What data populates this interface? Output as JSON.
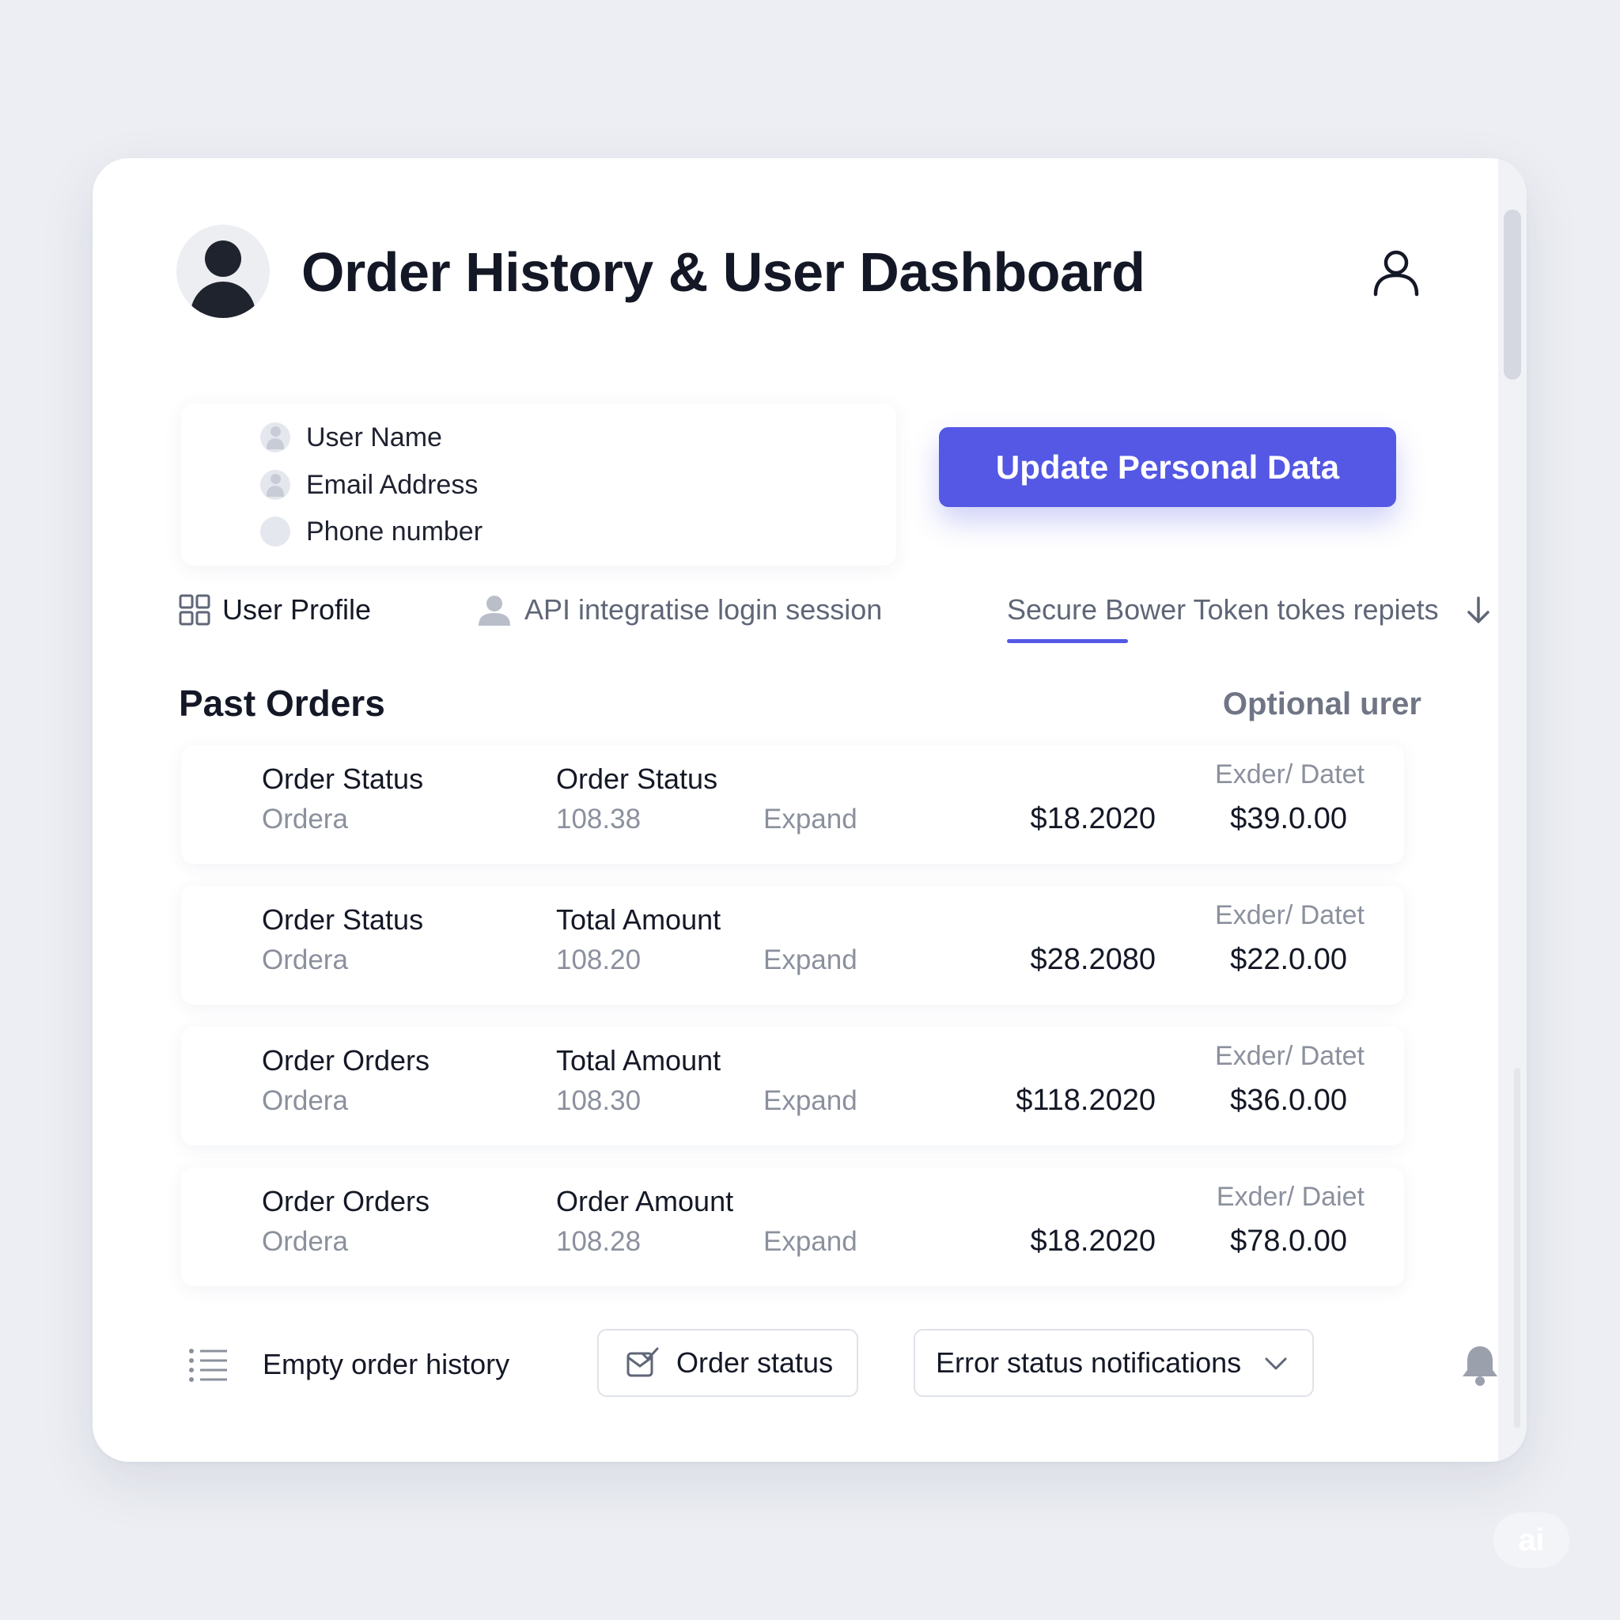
{
  "header": {
    "title": "Order History & User Dashboard"
  },
  "profile_fields": [
    {
      "label": "User Name",
      "icon": "user-icon"
    },
    {
      "label": "Email Address",
      "icon": "user-icon"
    },
    {
      "label": "Phone number",
      "icon": "circle-icon"
    }
  ],
  "update_button": "Update Personal Data",
  "tabs": [
    {
      "label": "User Profile",
      "icon": "grid-icon"
    },
    {
      "label": "API integratise login session",
      "icon": "user-icon"
    },
    {
      "label": "Secure Bower Token tokes repiets",
      "icon": "",
      "active": true
    }
  ],
  "orders_section": {
    "title": "Past Orders",
    "link": "Optional urer"
  },
  "orders": [
    {
      "col1_title": "Order Status",
      "col1_sub": "Ordera",
      "col2_title": "Order Status",
      "col2_sub": "108.38",
      "expand": "Expand",
      "amount": "$18.2020",
      "date_label": "Exder/ Datet",
      "total": "$39.0.00"
    },
    {
      "col1_title": "Order Status",
      "col1_sub": "Ordera",
      "col2_title": "Total Amount",
      "col2_sub": "108.20",
      "expand": "Expand",
      "amount": "$28.2080",
      "date_label": "Exder/ Datet",
      "total": "$22.0.00"
    },
    {
      "col1_title": "Order Orders",
      "col1_sub": "Ordera",
      "col2_title": "Total Amount",
      "col2_sub": "108.30",
      "expand": "Expand",
      "amount": "$118.2020",
      "date_label": "Exder/ Datet",
      "total": "$36.0.00"
    },
    {
      "col1_title": "Order Orders",
      "col1_sub": "Ordera",
      "col2_title": "Order Amount",
      "col2_sub": "108.28",
      "expand": "Expand",
      "amount": "$18.2020",
      "date_label": "Exder/ Daiet",
      "total": "$78.0.00"
    }
  ],
  "footer": {
    "empty_label": "Empty order history",
    "status_button": "Order status",
    "notifications_select": "Error status notifications"
  },
  "watermark": "ai",
  "colors": {
    "accent": "#5458e4",
    "background": "#eceef3",
    "card": "#ffffff",
    "muted_text": "#8b909d"
  }
}
